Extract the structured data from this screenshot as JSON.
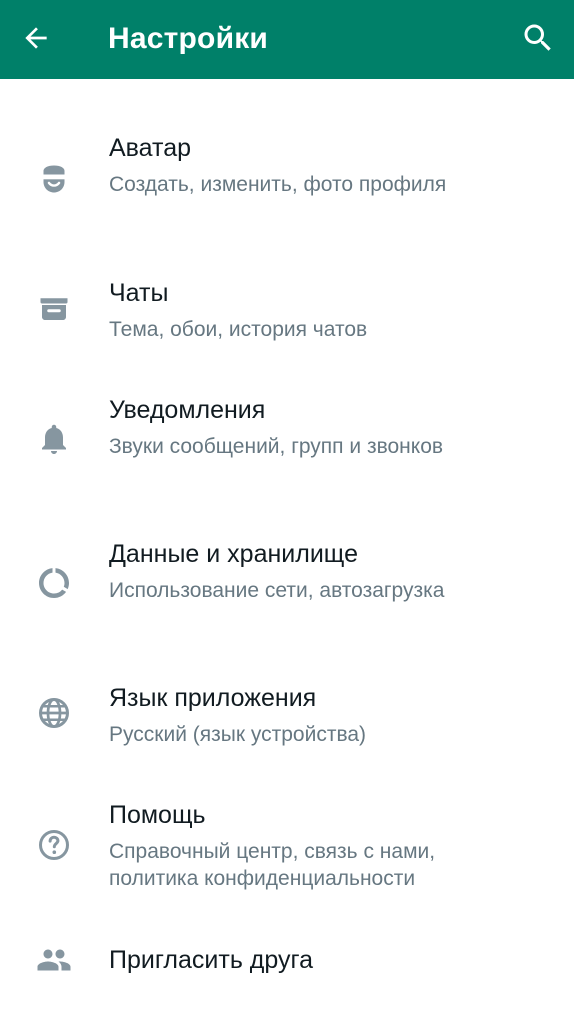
{
  "header": {
    "title": "Настройки",
    "background": "#008069",
    "back_icon": "arrow-left-icon",
    "search_icon": "search-icon"
  },
  "colors": {
    "primary_text": "#111b21",
    "secondary_text": "#667781",
    "icon": "#8696a0"
  },
  "settings": [
    {
      "label": "Аватар",
      "sub": "Создать, изменить, фото профиля",
      "icon": "avatar-icon"
    },
    {
      "label": "Чаты",
      "sub": "Тема, обои, история чатов",
      "icon": "chat-icon"
    },
    {
      "label": "Уведомления",
      "sub": "Звуки сообщений, групп и звонков",
      "icon": "bell-icon"
    },
    {
      "label": "Данные и хранилище",
      "sub": "Использование сети, автозагрузка",
      "icon": "data-usage-icon"
    },
    {
      "label": "Язык приложения",
      "sub": "Русский (язык устройства)",
      "icon": "globe-icon"
    },
    {
      "label": "Помощь",
      "sub": "Справочный центр, связь с нами, политика конфиденциальности",
      "icon": "help-icon"
    },
    {
      "label": "Пригласить друга",
      "icon": "people-icon"
    }
  ]
}
